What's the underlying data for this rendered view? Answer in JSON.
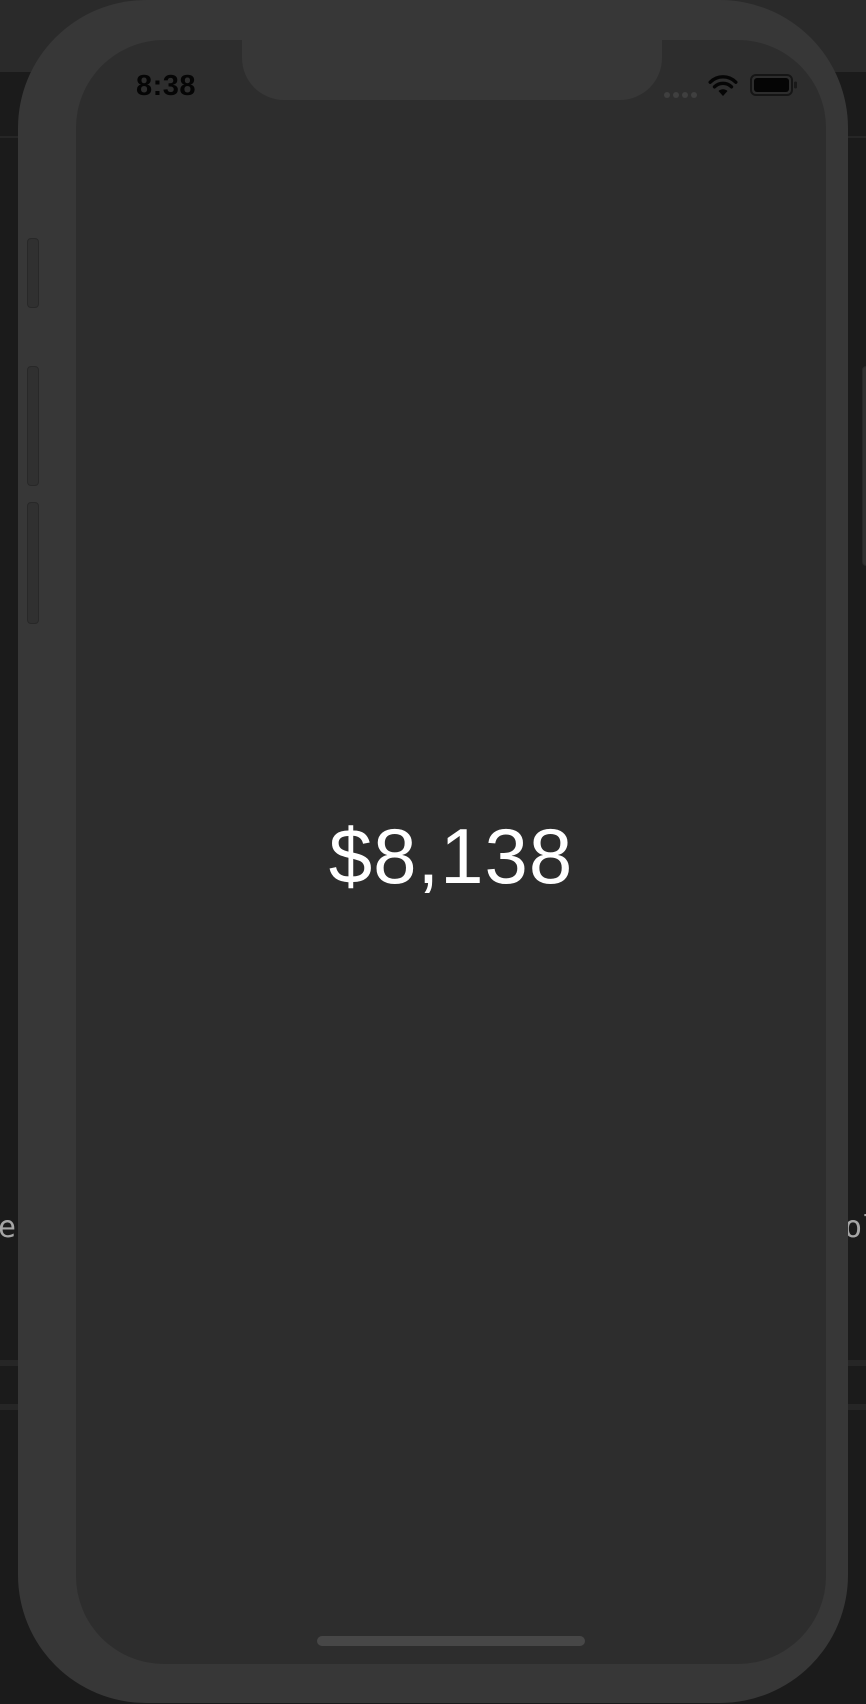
{
  "background": {
    "left_fragment": "e",
    "right_fragment": "ol"
  },
  "status_bar": {
    "time": "8:38",
    "signal_icon": "cellular-signal-dots",
    "wifi_icon": "wifi-icon",
    "battery_icon": "battery-full-icon"
  },
  "main": {
    "amount": "$8,138"
  },
  "colors": {
    "screen_background": "#2d2d2d",
    "device_frame": "#373737",
    "amount_text": "#ffffff",
    "status_text": "#050505"
  }
}
